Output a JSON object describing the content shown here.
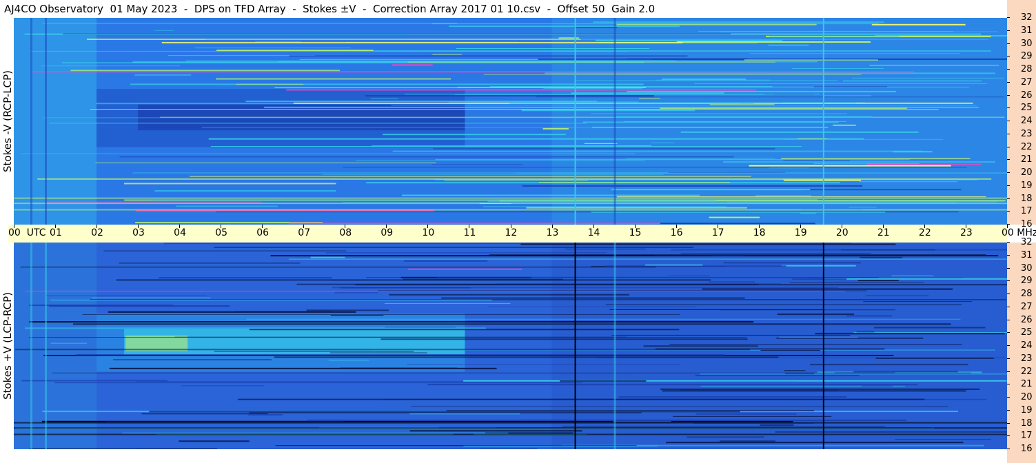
{
  "title": "AJ4CO Observatory  01 May 2023  -  DPS on TFD Array  -  Stokes ±V  -  Correction Array 2017 01 10.csv  -  Offset 50  Gain 2.0",
  "panels": [
    {
      "ylabel": "Stokes -V (RCP-LCP)",
      "polarity": "minus"
    },
    {
      "ylabel": "Stokes +V (LCP-RCP)",
      "polarity": "plus"
    }
  ],
  "chart_data": {
    "type": "heatmap",
    "title": "AJ4CO Observatory  01 May 2023  -  DPS on TFD Array  -  Stokes ±V  -  Correction Array 2017 01 10.csv  -  Offset 50  Gain 2.0",
    "x_axis": {
      "unit_label": "UTC",
      "ticks": [
        "00",
        "01",
        "02",
        "03",
        "04",
        "05",
        "06",
        "07",
        "08",
        "09",
        "10",
        "11",
        "12",
        "13",
        "14",
        "15",
        "16",
        "17",
        "18",
        "19",
        "20",
        "21",
        "22",
        "23",
        "00"
      ],
      "range": [
        0,
        24
      ]
    },
    "y_axis": {
      "unit_label": "MHz",
      "ticks": [
        "32",
        "31",
        "30",
        "29",
        "28",
        "27",
        "26",
        "25",
        "24",
        "23",
        "22",
        "21",
        "20",
        "19",
        "18",
        "17",
        "16"
      ],
      "range": [
        16,
        32
      ]
    },
    "series": [
      {
        "name": "Stokes -V (RCP-LCP)"
      },
      {
        "name": "Stokes +V (LCP-RCP)"
      }
    ],
    "colors": {
      "low": "#1a3fb0",
      "mid": "#2a78e6",
      "high": "#37c9e8",
      "hot": "#b8f070",
      "spike": "#ff40c0"
    },
    "features": {
      "vertical_lines_utc": [
        13.55,
        19.55
      ],
      "quiet_region_utc": [
        2.0,
        10.9
      ],
      "quiet_region_mhz": [
        23.3,
        25.3
      ]
    }
  }
}
